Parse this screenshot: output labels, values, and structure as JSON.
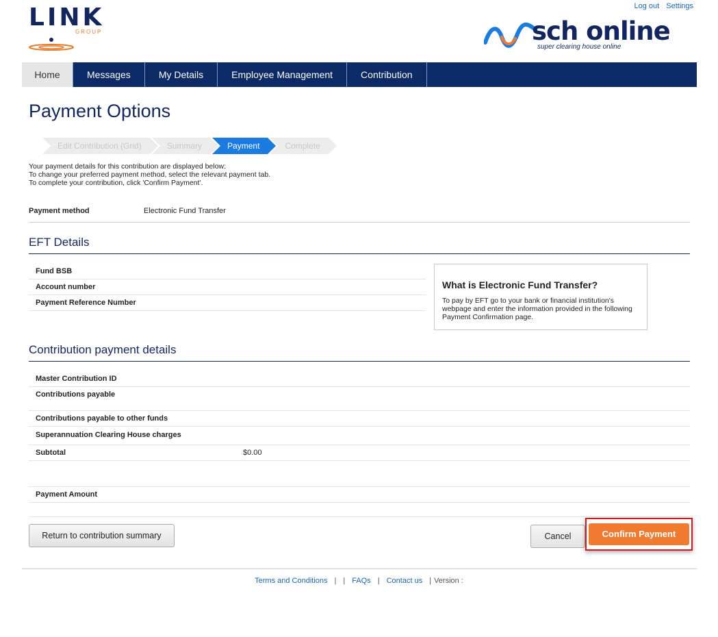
{
  "top_links": {
    "logout": "Log out",
    "settings": "Settings"
  },
  "logo_link": {
    "word": "LINK",
    "group": "GROUP"
  },
  "logo_sch": {
    "name": "sch online",
    "tagline": "super clearing house online"
  },
  "nav": [
    "Home",
    "Messages",
    "My Details",
    "Employee Management",
    "Contribution"
  ],
  "page_title": "Payment Options",
  "steps": [
    "Edit Contribution (Grid)",
    "Summary",
    "Payment",
    "Complete"
  ],
  "intro": [
    "Your payment details for this contribution are displayed below:",
    "To change your preferred payment method, select the relevant payment tab.",
    "To complete your contribution, click 'Confirm Payment'."
  ],
  "payment_method": {
    "label": "Payment method",
    "value": "Electronic Fund Transfer"
  },
  "eft": {
    "heading": "EFT Details",
    "rows": [
      "Fund BSB",
      "Account number",
      "Payment Reference Number"
    ]
  },
  "info_box": {
    "title": "What is Electronic Fund Transfer?",
    "text": "To pay by EFT go to your bank or financial institution's webpage and enter the information provided in the following Payment Confirmation page."
  },
  "contribution": {
    "heading": "Contribution payment details",
    "rows": [
      {
        "label": "Master Contribution ID",
        "value": ""
      },
      {
        "label": "Contributions payable",
        "value": ""
      },
      {
        "label": "Contributions payable to other funds",
        "value": ""
      },
      {
        "label": "Superannuation Clearing House charges",
        "value": ""
      },
      {
        "label": "Subtotal",
        "value": "$0.00"
      },
      {
        "label": "",
        "value": ""
      },
      {
        "label": "Payment Amount",
        "value": ""
      }
    ]
  },
  "buttons": {
    "return": "Return to contribution summary",
    "cancel": "Cancel",
    "confirm": "Confirm Payment"
  },
  "footer": {
    "terms": "Terms and Conditions",
    "faqs": "FAQs",
    "contact": "Contact us",
    "version": "Version :"
  },
  "colors": {
    "navy": "#0b2a66",
    "accent": "#f07a30",
    "step_active": "#1a7ce0"
  }
}
